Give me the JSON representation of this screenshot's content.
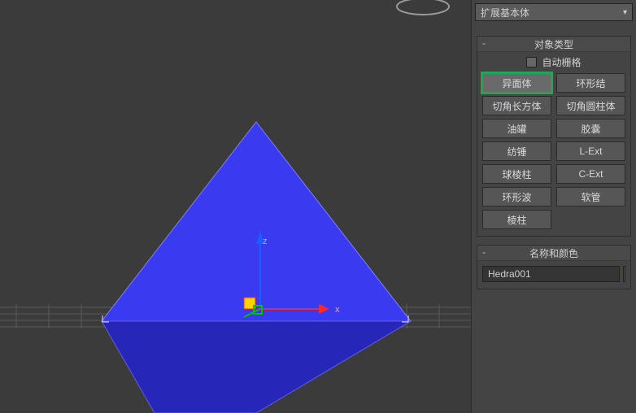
{
  "dropdown": {
    "label": "扩展基本体"
  },
  "rollout_types": {
    "title": "对象类型",
    "autogrid_label": "自动栅格",
    "buttons": [
      {
        "label": "异面体",
        "highlight": true
      },
      {
        "label": "环形结",
        "highlight": false
      },
      {
        "label": "切角长方体",
        "highlight": false
      },
      {
        "label": "切角圆柱体",
        "highlight": false
      },
      {
        "label": "油罐",
        "highlight": false
      },
      {
        "label": "胶囊",
        "highlight": false
      },
      {
        "label": "纺锤",
        "highlight": false
      },
      {
        "label": "L-Ext",
        "highlight": false
      },
      {
        "label": "球棱柱",
        "highlight": false
      },
      {
        "label": "C-Ext",
        "highlight": false
      },
      {
        "label": "环形波",
        "highlight": false
      },
      {
        "label": "软管",
        "highlight": false
      },
      {
        "label": "棱柱",
        "highlight": false
      }
    ]
  },
  "rollout_name": {
    "title": "名称和颜色",
    "object_name": "Hedra001",
    "color": "#3334ff"
  },
  "gizmo": {
    "x_label": "x",
    "z_label": "z"
  }
}
